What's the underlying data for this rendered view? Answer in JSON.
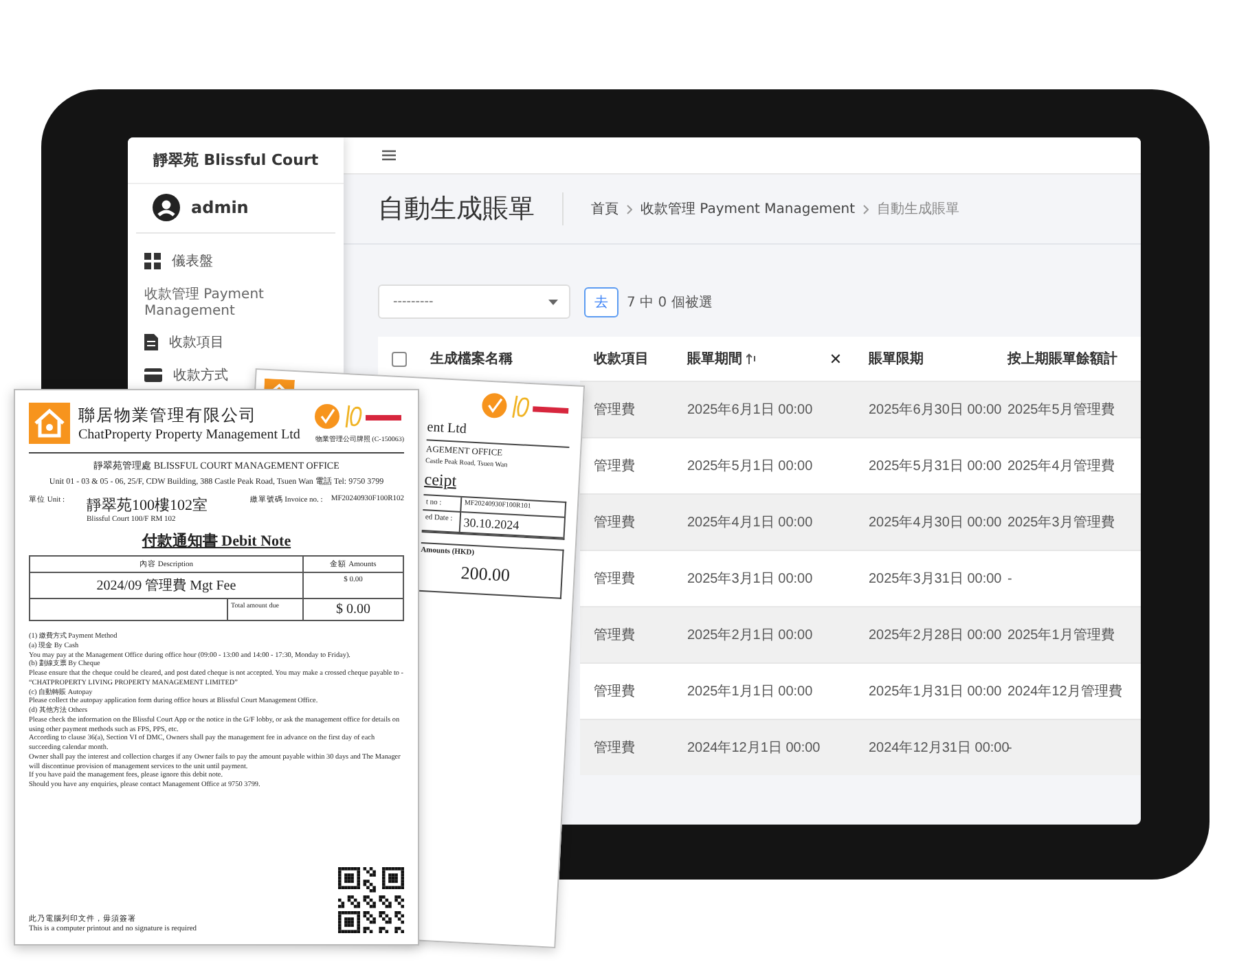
{
  "sidebar": {
    "brand": "靜翠苑 Blissful Court",
    "user": "admin",
    "items": [
      {
        "kind": "link",
        "label": "儀表盤"
      },
      {
        "kind": "section",
        "label": "收款管理 Payment Management"
      },
      {
        "kind": "link",
        "label": "收款項目"
      },
      {
        "kind": "link",
        "label": "收款方式"
      }
    ]
  },
  "header": {
    "title": "自動生成賬單",
    "breadcrumb": [
      "首頁",
      "收款管理 Payment Management",
      "自動生成賬單"
    ]
  },
  "toolbar": {
    "action_select": "---------",
    "go_button": "去",
    "selection_count": "7 中 0 個被選"
  },
  "table": {
    "select_all_checked": false,
    "clear_sort": "✕",
    "columns": [
      {
        "label": "生成檔案名稱",
        "sorted": false
      },
      {
        "label": "收款項目",
        "sorted": false
      },
      {
        "label": "賬單期間",
        "sorted": true
      },
      {
        "label": "賬單限期",
        "sorted": false
      },
      {
        "label": "按上期賬單餘額計",
        "sorted": false
      }
    ],
    "rows": [
      {
        "item": "管理費",
        "period_start": "2025年6月1日 00:00",
        "period_end": "2025年6月30日 00:00",
        "previous": "2025年5月管理費"
      },
      {
        "item": "管理費",
        "period_start": "2025年5月1日 00:00",
        "period_end": "2025年5月31日 00:00",
        "previous": "2025年4月管理費"
      },
      {
        "item": "管理費",
        "period_start": "2025年4月1日 00:00",
        "period_end": "2025年4月30日 00:00",
        "previous": "2025年3月管理費"
      },
      {
        "item": "管理費",
        "period_start": "2025年3月1日 00:00",
        "period_end": "2025年3月31日 00:00",
        "previous": "-"
      },
      {
        "item": "管理費",
        "period_start": "2025年2月1日 00:00",
        "period_end": "2025年2月28日 00:00",
        "previous": "2025年1月管理費"
      },
      {
        "item": "管理費",
        "period_start": "2025年1月1日 00:00",
        "period_end": "2025年1月31日 00:00",
        "previous": "2024年12月管理費"
      },
      {
        "item": "管理費",
        "period_start": "2024年12月1日 00:00",
        "period_end": "2024年12月31日 00:00",
        "previous": "-"
      }
    ]
  },
  "receipt": {
    "company": "ent Ltd",
    "office": "AGEMENT OFFICE",
    "address": "Castle Peak Road, Tsuen Wan",
    "title": "ceipt",
    "fields": [
      {
        "label": "t no :",
        "value": "MF20240930F100R101"
      },
      {
        "label": "ed Date :",
        "value": "30.10.2024"
      }
    ],
    "amount_label": "Amounts (HKD)",
    "amount": "200.00"
  },
  "debit_note": {
    "company_zh": "聯居物業管理有限公司",
    "company_en": "ChatProperty Property Management Ltd",
    "licence": "物業管理公司牌照 (C-150063)",
    "office": "靜翠苑管理處 BLISSFUL COURT MANAGEMENT OFFICE",
    "address": "Unit 01 - 03 & 05 - 06, 25/F, CDW Building, 388 Castle Peak Road, Tsuen Wan 電話 Tel: 9750 3799",
    "unit_label": "單位 Unit :",
    "unit_zh": "靜翠苑100樓102室",
    "unit_en": "Blissful Court 100/F RM 102",
    "invoice_label": "繳單號碼 Invoice no. :",
    "invoice_no": "MF20240930F100R102",
    "title": "付款通知書 Debit Note",
    "description_header": "內容 Description",
    "amount_header": "金額 Amounts",
    "description": "2024/09 管理費 Mgt Fee",
    "amount": "$ 0.00",
    "total_label": "Total amount due",
    "total": "$ 0.00",
    "body": [
      "(1) 繳費方式 Payment Method",
      "(a) 現金 By Cash",
      "You may pay at the Management Office during office hour (09:00 - 13:00 and 14:00 - 17:30, Monday to Friday).",
      "(b) 劃線支票 By Cheque",
      "Please ensure that the cheque could be cleared, and post dated cheque is not accepted. You may make a crossed cheque payable to - “CHATPROPERTY LIVING PROPERTY MANAGEMENT LIMITED”",
      "(c) 自動轉賬 Autopay",
      "Please collect the autopay application form during office hours at Blissful Court Management Office.",
      "(d) 其他方法 Others",
      "Please check the information on the Blissful Court App or the notice in the G/F lobby, or ask the management office for details on using other payment methods such as FPS, PPS, etc.",
      "According to clause 36(a), Section VI of DMC, Owners shall pay the management fee in advance on the first day of each succeeding calendar month.",
      "Owner shall pay the interest and collection charges if any Owner fails to pay the amount payable within 30 days and The Manager will discontinue provision of management services to the unit until payment.",
      "If you have paid the management fees, please ignore this debit note.",
      "Should you have any enquiries, please contact Management Office at 9750 3799."
    ],
    "footer_zh": "此乃電腦列印文件，毋須簽署",
    "footer_en": "This is a computer printout and no signature is required"
  }
}
